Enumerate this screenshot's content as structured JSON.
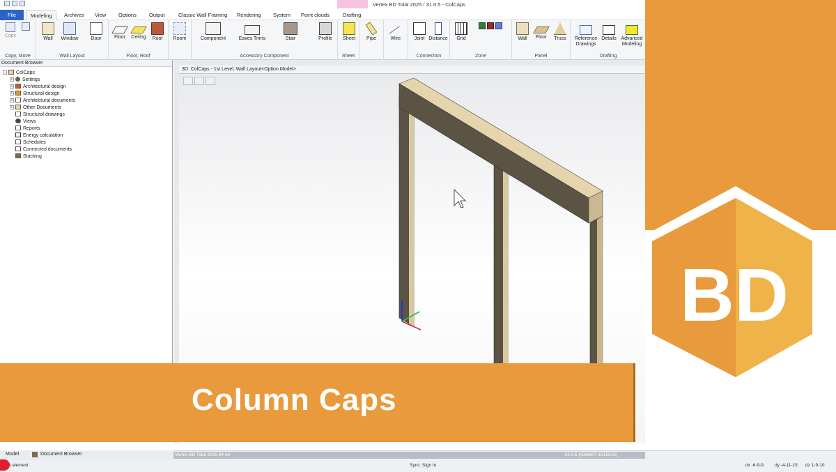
{
  "window": {
    "title": "Vertex BD Total 2025 / 31.0.5 - ColCaps"
  },
  "tabs": [
    "File",
    "Modeling",
    "Archives",
    "View",
    "Options",
    "Output",
    "Classic Wall Framing",
    "Rendering",
    "System",
    "Point clouds",
    "Drafting"
  ],
  "ribbon": {
    "copy_move": {
      "label": "Copy, Move",
      "copy": "Copy"
    },
    "wall_layout": {
      "label": "Wall Layout",
      "wall": "Wall",
      "window": "Window",
      "door": "Door"
    },
    "floor_roof": {
      "label": "Floor, Roof",
      "floor": "Floor",
      "ceiling": "Ceiling",
      "roof": "Roof"
    },
    "room": "Room",
    "accessory": {
      "label": "Accessory Component",
      "component": "Component",
      "eaves_trims": "Eaves Trims",
      "stair": "Stair",
      "profile": "Profile"
    },
    "sheet": {
      "label": "Sheet",
      "sheet": "Sheet"
    },
    "pipe": "Pipe",
    "wire": "Wire",
    "connection": {
      "label": "Connection",
      "joint": "Joint",
      "distance": "Distance"
    },
    "zone": {
      "label": "Zone",
      "grid": "Grid"
    },
    "panel": {
      "label": "Panel",
      "wall": "Wall",
      "floor": "Floor",
      "truss": "Truss"
    },
    "drafting": {
      "label": "Drafting",
      "reference": "Reference",
      "drawings": "Drawings",
      "details": "Details",
      "advanced": "Advanced",
      "modeling": "Modeling"
    }
  },
  "document_browser": {
    "title": "Document Browser",
    "root": "ColCaps",
    "items": [
      "Settings",
      "Architectural design",
      "Structural design",
      "Architectural documents",
      "Other Documents",
      "Structural drawings",
      "Views",
      "Reports",
      "Energy calculation",
      "Schedules",
      "Connected documents",
      "Stacking"
    ]
  },
  "viewport": {
    "title": "3D: ColCaps - 1st Level, Wall Layout<Option Model>"
  },
  "bottom_tabs": {
    "model": "Model",
    "document_browser": "Document Browser"
  },
  "status": {
    "product": "Vertex BD Total  2025  64-bit",
    "version": "31.0.5 (r196807-1515516)",
    "left": "t element",
    "sync": "Sync: Sign In",
    "dx": "dx -6-9-9",
    "dy": "dy -4-11-15",
    "dz": "dz 1-9-10"
  },
  "banner": {
    "title": "Column Caps"
  },
  "logo": {
    "text": "BD"
  },
  "colors": {
    "accent": "#e99a3c",
    "file_tab": "#2c63c7",
    "beam": "#5b5344"
  }
}
